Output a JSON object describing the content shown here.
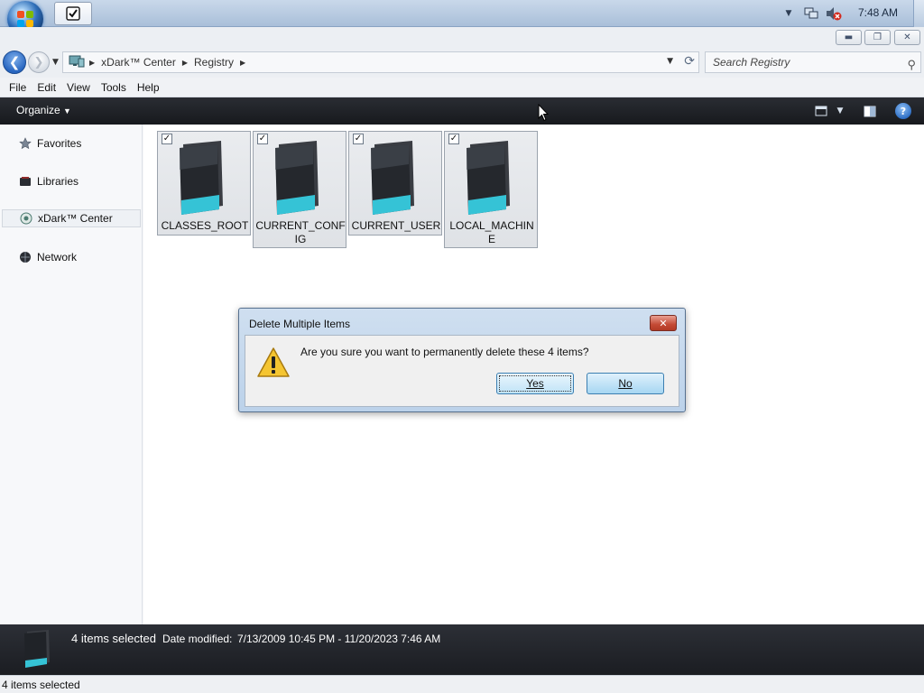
{
  "taskbar": {
    "clock": "7:48 AM",
    "app_icon": "checkbox-icon",
    "tray_icons": [
      "tray-chevron-icon",
      "network-icon",
      "volume-muted-icon"
    ]
  },
  "caption": {
    "buttons": [
      "minimize",
      "restore",
      "close"
    ]
  },
  "address": {
    "segments": [
      "xDark™ Center",
      "Registry"
    ],
    "search_placeholder": "Search Registry"
  },
  "menu": [
    "File",
    "Edit",
    "View",
    "Tools",
    "Help"
  ],
  "command_bar": {
    "organize": "Organize"
  },
  "sidebar": {
    "items": [
      {
        "label": "Favorites",
        "icon": "star-icon"
      },
      {
        "label": "Libraries",
        "icon": "library-icon"
      },
      {
        "label": "xDark™ Center",
        "icon": "xdark-center-icon",
        "selected": true
      },
      {
        "label": "Network",
        "icon": "network-icon"
      }
    ]
  },
  "files": [
    {
      "name": "CLASSES_ROOT",
      "checked": true
    },
    {
      "name": "CURRENT_CONFIG",
      "checked": true
    },
    {
      "name": "CURRENT_USER",
      "checked": true
    },
    {
      "name": "LOCAL_MACHINE",
      "checked": true
    }
  ],
  "dialog": {
    "title": "Delete Multiple Items",
    "message": "Are you sure you want to permanently delete these 4 items?",
    "yes": "Yes",
    "no": "No"
  },
  "details": {
    "count": "4 items selected",
    "date_label": "Date modified:",
    "date_value": "7/13/2009 10:45 PM - 11/20/2023 7:46 AM"
  },
  "status": {
    "text": "4 items selected"
  },
  "colors": {
    "command_bar": "#1f2227",
    "dialog_frame": "#c4d8ee",
    "folder_accent": "#35c3d6"
  }
}
